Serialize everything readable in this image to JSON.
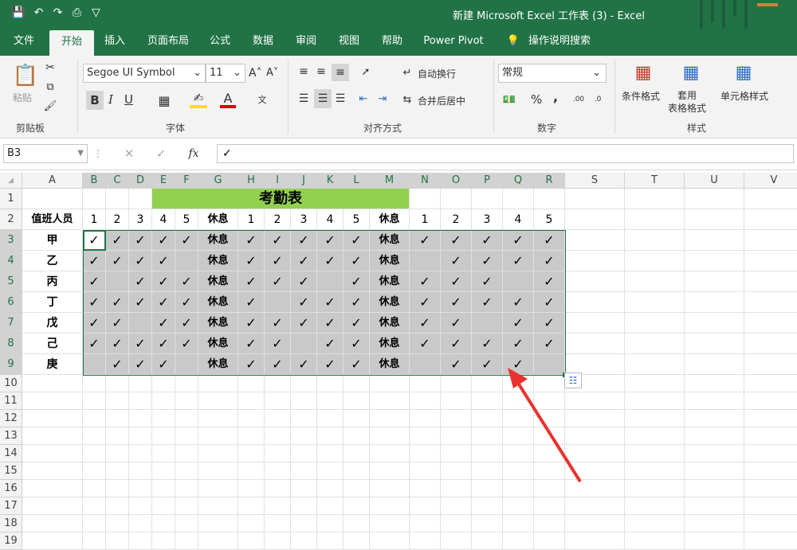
{
  "window": {
    "title": "新建 Microsoft Excel 工作表 (3)  -  Excel"
  },
  "qat": {
    "save": "💾",
    "undo": "↶",
    "redo": "↷",
    "preview": "⎙",
    "more": "▽"
  },
  "tabs": [
    "文件",
    "开始",
    "插入",
    "页面布局",
    "公式",
    "数据",
    "审阅",
    "视图",
    "帮助",
    "Power Pivot",
    "操作说明搜索"
  ],
  "active_tab": "开始",
  "ribbon": {
    "clipboard": {
      "paste": "粘贴",
      "label": "剪贴板"
    },
    "font": {
      "family": "Segoe UI Symbol",
      "size": "11",
      "grow": "A˄",
      "shrink": "A˅",
      "bold": "B",
      "italic": "I",
      "underline": "U",
      "label": "字体"
    },
    "alignment": {
      "wrap": "自动换行",
      "merge": "合并后居中",
      "label": "对齐方式"
    },
    "number": {
      "format": "常规",
      "percent": "%",
      "comma": ",",
      "label": "数字"
    },
    "styles": {
      "conditional": "条件格式",
      "table": "套用\n表格格式",
      "cell": "单元格样式",
      "label": "样式"
    }
  },
  "formula_bar": {
    "name_box": "B3",
    "fx": "fx",
    "content": "✓"
  },
  "columns": [
    "A",
    "B",
    "C",
    "D",
    "E",
    "F",
    "G",
    "H",
    "I",
    "J",
    "K",
    "L",
    "M",
    "N",
    "O",
    "P",
    "Q",
    "R",
    "S",
    "T",
    "U",
    "V"
  ],
  "rows": [
    "1",
    "2",
    "3",
    "4",
    "5",
    "6",
    "7",
    "8",
    "9",
    "10",
    "11",
    "12",
    "13",
    "14",
    "15",
    "16",
    "17",
    "18",
    "19"
  ],
  "sheet": {
    "title": "考勤表",
    "staff_header": "值班人员",
    "day_headers": [
      "1",
      "2",
      "3",
      "4",
      "5",
      "休息",
      "1",
      "2",
      "3",
      "4",
      "5",
      "休息",
      "1",
      "2",
      "3",
      "4",
      "5"
    ],
    "staff": [
      {
        "name": "甲",
        "days": [
          "✓",
          "✓",
          "✓",
          "✓",
          "✓",
          "休息",
          "✓",
          "✓",
          "✓",
          "✓",
          "✓",
          "休息",
          "✓",
          "✓",
          "✓",
          "✓",
          "✓"
        ]
      },
      {
        "name": "乙",
        "days": [
          "✓",
          "✓",
          "✓",
          "✓",
          "",
          "休息",
          "✓",
          "✓",
          "✓",
          "✓",
          "✓",
          "休息",
          "",
          "✓",
          "✓",
          "✓",
          "✓"
        ]
      },
      {
        "name": "丙",
        "days": [
          "✓",
          "",
          "✓",
          "✓",
          "✓",
          "休息",
          "✓",
          "✓",
          "✓",
          "",
          "✓",
          "休息",
          "✓",
          "✓",
          "✓",
          "",
          "✓"
        ]
      },
      {
        "name": "丁",
        "days": [
          "✓",
          "✓",
          "✓",
          "✓",
          "✓",
          "休息",
          "✓",
          "",
          "✓",
          "✓",
          "✓",
          "休息",
          "✓",
          "✓",
          "✓",
          "✓",
          "✓"
        ]
      },
      {
        "name": "戊",
        "days": [
          "✓",
          "✓",
          "",
          "✓",
          "✓",
          "休息",
          "✓",
          "✓",
          "✓",
          "✓",
          "✓",
          "休息",
          "✓",
          "✓",
          "",
          "✓",
          "✓"
        ]
      },
      {
        "name": "己",
        "days": [
          "✓",
          "✓",
          "✓",
          "✓",
          "✓",
          "休息",
          "✓",
          "✓",
          "",
          "✓",
          "✓",
          "休息",
          "✓",
          "✓",
          "✓",
          "✓",
          "✓"
        ]
      },
      {
        "name": "庚",
        "days": [
          "",
          "✓",
          "✓",
          "✓",
          "",
          "休息",
          "✓",
          "✓",
          "✓",
          "✓",
          "✓",
          "休息",
          "",
          "✓",
          "✓",
          "✓",
          ""
        ]
      }
    ]
  },
  "colors": {
    "excel_green": "#217346",
    "title_fill": "#92d050",
    "selection_fill": "#c9c9c9",
    "arrow": "#e8322f"
  }
}
